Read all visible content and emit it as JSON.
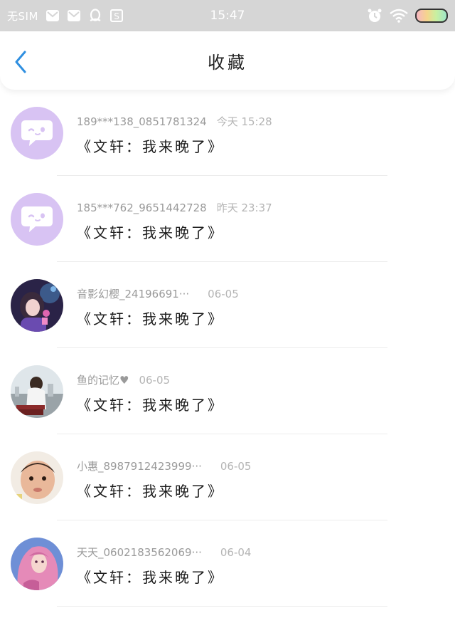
{
  "status_bar": {
    "carrier": "无SIM",
    "time": "15:47",
    "notification_icons": [
      "mail-icon",
      "mail-icon",
      "qq-icon",
      "s-app-icon"
    ],
    "right_icons": [
      "alarm-icon",
      "wifi-icon",
      "battery-icon"
    ]
  },
  "header": {
    "back_icon": "chevron-left-icon",
    "title": "收藏",
    "accent_color": "#2f8fe0"
  },
  "items": [
    {
      "name": "189***138_0851781324",
      "time": "今天 15:28",
      "message": "《文轩：我来晚了》",
      "avatar": "default"
    },
    {
      "name": "185***762_9651442728",
      "time": "昨天 23:37",
      "message": "《文轩：我来晚了》",
      "avatar": "default"
    },
    {
      "name": "音影幻樱_24196691···",
      "time": "06-05",
      "message": "《文轩：我来晚了》",
      "avatar": "photo-anime-girl"
    },
    {
      "name": "鱼的记忆♥",
      "time": "06-05",
      "message": "《文轩：我来晚了》",
      "avatar": "photo-girl-city"
    },
    {
      "name": "小惠_8987912423999···",
      "time": "06-05",
      "message": "《文轩：我来晚了》",
      "avatar": "photo-baby"
    },
    {
      "name": "天天_0602183562069···",
      "time": "06-04",
      "message": "《文轩：我来晚了》",
      "avatar": "photo-pink-hair"
    }
  ]
}
